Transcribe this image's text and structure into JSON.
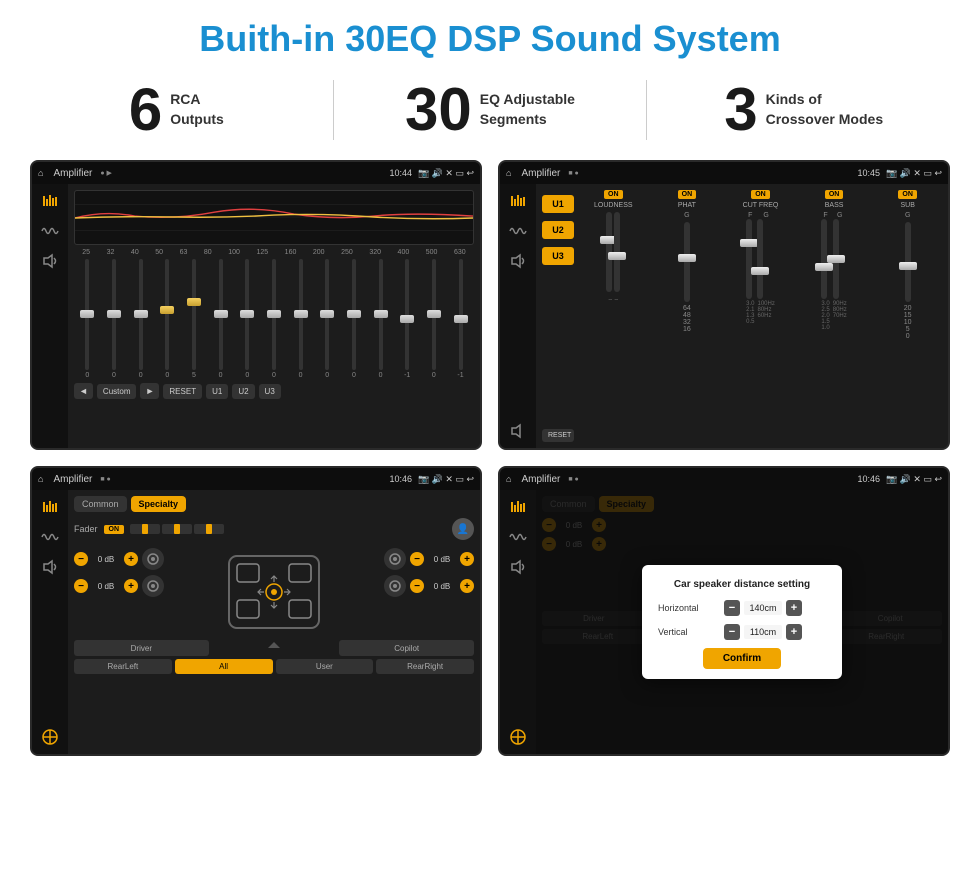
{
  "page": {
    "title": "Buith-in 30EQ DSP Sound System",
    "bg_color": "#ffffff"
  },
  "features": [
    {
      "number": "6",
      "text_line1": "RCA",
      "text_line2": "Outputs"
    },
    {
      "number": "30",
      "text_line1": "EQ Adjustable",
      "text_line2": "Segments"
    },
    {
      "number": "3",
      "text_line1": "Kinds of",
      "text_line2": "Crossover Modes"
    }
  ],
  "screens": [
    {
      "id": "screen1",
      "status_bar": {
        "home": "⌂",
        "app_name": "Amplifier",
        "dots": "● ▶",
        "pin": "📍",
        "time": "10:44",
        "icons": "📷 🔊 ✕ ▭ ↩"
      },
      "eq_labels": [
        "25",
        "32",
        "40",
        "50",
        "63",
        "80",
        "100",
        "125",
        "160",
        "200",
        "250",
        "320",
        "400",
        "500",
        "630"
      ],
      "sliders": [
        {
          "value": "0",
          "pos": 50
        },
        {
          "value": "0",
          "pos": 50
        },
        {
          "value": "0",
          "pos": 50
        },
        {
          "value": "0",
          "pos": 45
        },
        {
          "value": "5",
          "pos": 40
        },
        {
          "value": "0",
          "pos": 50
        },
        {
          "value": "0",
          "pos": 50
        },
        {
          "value": "0",
          "pos": 50
        },
        {
          "value": "0",
          "pos": 50
        },
        {
          "value": "0",
          "pos": 50
        },
        {
          "value": "0",
          "pos": 50
        },
        {
          "value": "0",
          "pos": 50
        },
        {
          "value": "-1",
          "pos": 53
        },
        {
          "value": "0",
          "pos": 50
        },
        {
          "value": "-1",
          "pos": 53
        }
      ],
      "bottom_controls": {
        "prev": "◄",
        "preset": "Custom",
        "next": "►",
        "reset": "RESET",
        "u1": "U1",
        "u2": "U2",
        "u3": "U3"
      }
    },
    {
      "id": "screen2",
      "status_bar": {
        "home": "⌂",
        "app_name": "Amplifier",
        "dots": "■ ●",
        "pin": "📍",
        "time": "10:45",
        "icons": "📷 🔊 ✕ ▭ ↩"
      },
      "u_buttons": [
        "U1",
        "U2",
        "U3"
      ],
      "sections": [
        {
          "on": true,
          "label": "LOUDNESS",
          "value": ""
        },
        {
          "on": true,
          "label": "PHAT",
          "value": "G"
        },
        {
          "on": true,
          "label": "CUT FREQ",
          "value": "F"
        },
        {
          "on": true,
          "label": "BASS",
          "value": ""
        },
        {
          "on": true,
          "label": "SUB",
          "value": "G"
        }
      ],
      "reset_btn": "RESET"
    },
    {
      "id": "screen3",
      "status_bar": {
        "home": "⌂",
        "app_name": "Amplifier",
        "dots": "■ ●",
        "pin": "📍",
        "time": "10:46",
        "icons": "📷 🔊 ✕ ▭ ↩"
      },
      "tabs": [
        "Common",
        "Specialty"
      ],
      "active_tab": "Specialty",
      "fader_label": "Fader",
      "on_label": "ON",
      "controls": {
        "fl": "0 dB",
        "fr": "0 dB",
        "rl": "0 dB",
        "rr": "0 dB"
      },
      "bottom_btns": [
        "Driver",
        "",
        "Copilot",
        "RearLeft",
        "All",
        "User",
        "RearRight"
      ]
    },
    {
      "id": "screen4",
      "status_bar": {
        "home": "⌂",
        "app_name": "Amplifier",
        "dots": "■ ●",
        "pin": "📍",
        "time": "10:46",
        "icons": "📷 🔊 ✕ ▭ ↩"
      },
      "tabs": [
        "Common",
        "Specialty"
      ],
      "dialog": {
        "title": "Car speaker distance setting",
        "horizontal_label": "Horizontal",
        "horizontal_value": "140cm",
        "vertical_label": "Vertical",
        "vertical_value": "110cm",
        "confirm_btn": "Confirm"
      },
      "controls_right": {
        "db1": "0 dB",
        "db2": "0 dB"
      },
      "bottom_btns_visible": [
        "Driver",
        "Copilot",
        "RearLeft",
        "RearRight"
      ]
    }
  ]
}
